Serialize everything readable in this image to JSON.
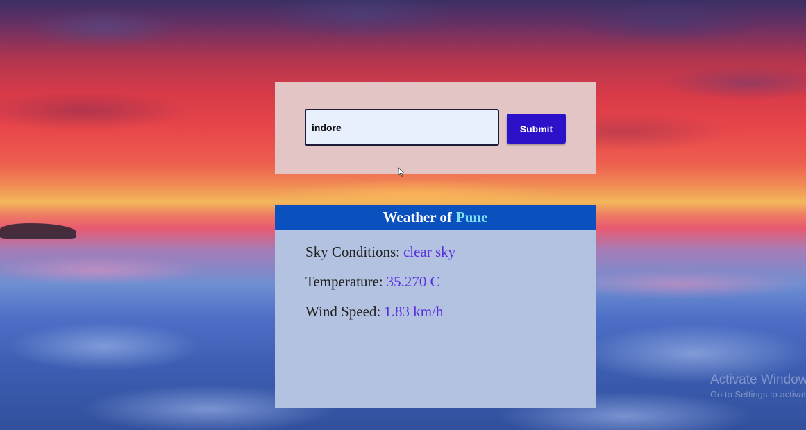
{
  "search": {
    "value": "indore",
    "submit_label": "Submit"
  },
  "weather": {
    "title_prefix": "Weather of",
    "city": "Pune",
    "sky_label": "Sky Conditions:",
    "sky_value": "clear sky",
    "temp_label": "Temperature:",
    "temp_value": "35.270 C",
    "wind_label": "Wind Speed:",
    "wind_value": "1.83 km/h"
  },
  "watermark": {
    "line1": "Activate Windows",
    "line2": "Go to Settings to activate Windows."
  },
  "colors": {
    "submit_bg": "#2b12c8",
    "header_bg": "#0a50bf",
    "city_accent": "#7ee0f0",
    "value_accent": "#5b2fe0"
  }
}
